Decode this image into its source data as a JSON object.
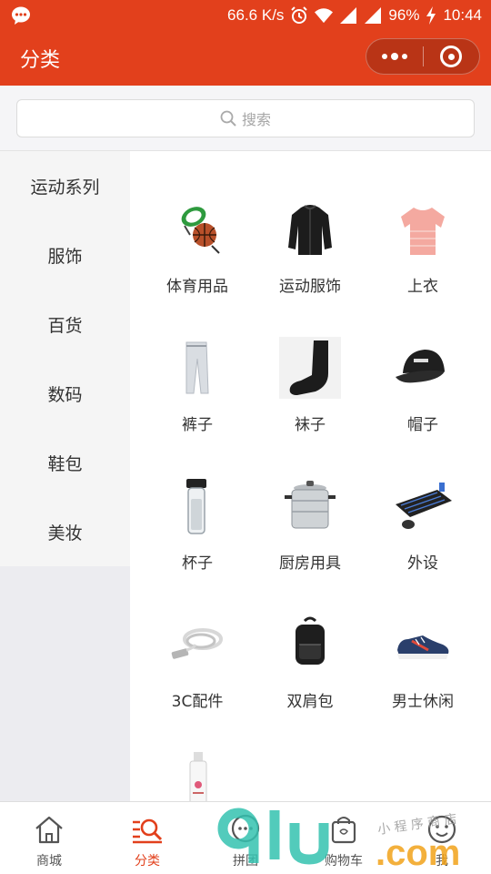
{
  "status_bar": {
    "speed": "66.6 K/s",
    "battery": "96%",
    "time": "10:44"
  },
  "header": {
    "title": "分类"
  },
  "search": {
    "placeholder": "搜索"
  },
  "sidebar": {
    "items": [
      {
        "label": "运动系列"
      },
      {
        "label": "服饰"
      },
      {
        "label": "百货"
      },
      {
        "label": "数码"
      },
      {
        "label": "鞋包"
      },
      {
        "label": "美妆"
      }
    ]
  },
  "grid": {
    "items": [
      {
        "label": "体育用品",
        "icon": "sports-goods-icon"
      },
      {
        "label": "运动服饰",
        "icon": "sports-jacket-icon"
      },
      {
        "label": "上衣",
        "icon": "top-shirt-icon"
      },
      {
        "label": "裤子",
        "icon": "pants-icon"
      },
      {
        "label": "袜子",
        "icon": "sock-icon"
      },
      {
        "label": "帽子",
        "icon": "cap-icon"
      },
      {
        "label": "杯子",
        "icon": "bottle-icon"
      },
      {
        "label": "厨房用具",
        "icon": "pot-icon"
      },
      {
        "label": "外设",
        "icon": "keyboard-icon"
      },
      {
        "label": "3C配件",
        "icon": "cable-icon"
      },
      {
        "label": "双肩包",
        "icon": "backpack-icon"
      },
      {
        "label": "男士休闲",
        "icon": "sneaker-icon"
      },
      {
        "label": "",
        "icon": "cosmetic-bottle-icon"
      }
    ]
  },
  "tabbar": {
    "tabs": [
      {
        "label": "商城",
        "icon": "home-icon"
      },
      {
        "label": "分类",
        "icon": "category-search-icon"
      },
      {
        "label": "拼团",
        "icon": "chat-group-icon"
      },
      {
        "label": "购物车",
        "icon": "shopping-bag-icon"
      },
      {
        "label": "我",
        "icon": "face-icon"
      }
    ],
    "active_index": 1
  },
  "watermark": {
    "text": "9lu",
    "domain": ".com",
    "handwriting": "小程序商店"
  },
  "colors": {
    "brand": "#e2401c",
    "watermark_teal": "#35c2b0",
    "watermark_orange": "#f2a31b"
  }
}
